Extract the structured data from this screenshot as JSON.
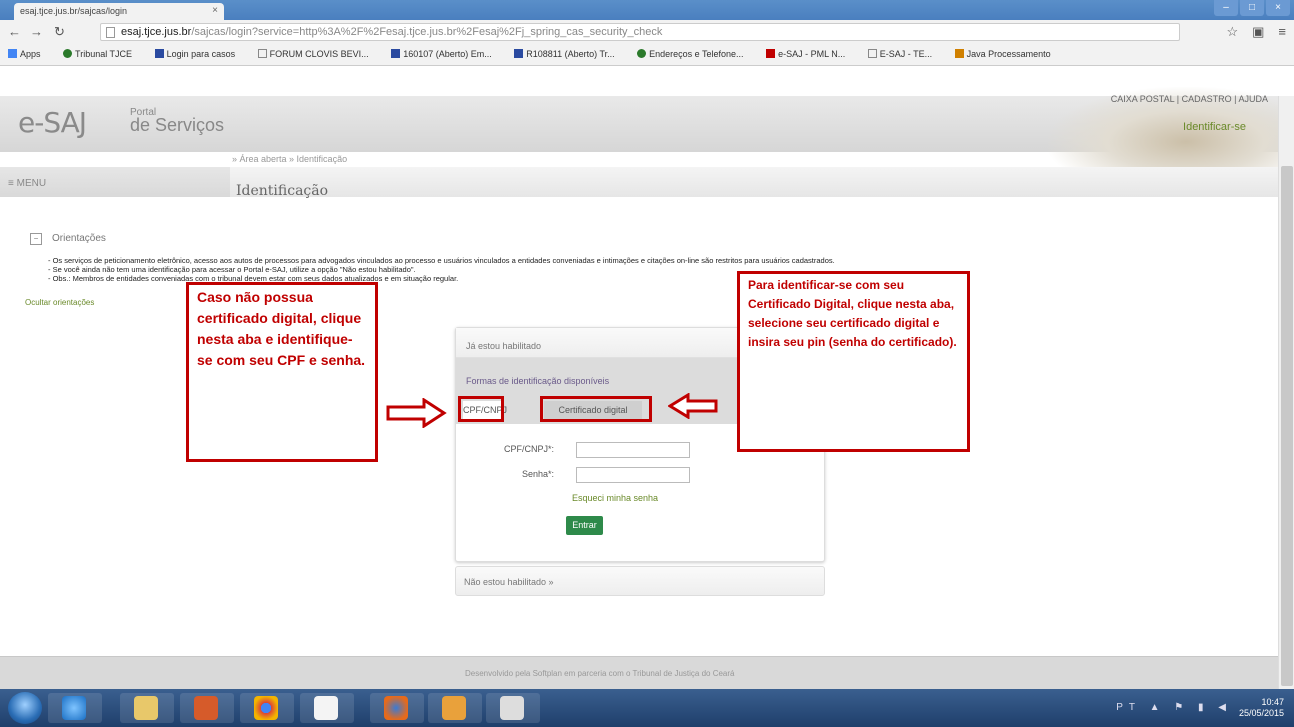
{
  "browser": {
    "tab_title": "esaj.tjce.jus.br/sajcas/login",
    "tab_close": "×",
    "url_host": "esaj.tjce.jus.br",
    "url_path": "/sajcas/login?service=http%3A%2F%2Fesaj.tjce.jus.br%2Fesaj%2Fj_spring_cas_security_check",
    "bookmarks": [
      {
        "label": "Apps",
        "color": "#4285f4"
      },
      {
        "label": "Tribunal TJCE",
        "color": "#2b7a2b"
      },
      {
        "label": "Login para casos",
        "color": "#2a4aa0"
      },
      {
        "label": "FORUM CLOVIS BEVI...",
        "color": "#888888"
      },
      {
        "label": "160107 (Aberto) Em...",
        "color": "#2a4aa0"
      },
      {
        "label": "R108811 (Aberto) Tr...",
        "color": "#2a4aa0"
      },
      {
        "label": "Endereços e Telefone...",
        "color": "#2b7a2b"
      },
      {
        "label": "e-SAJ - PML N...",
        "color": "#c00000"
      },
      {
        "label": "E-SAJ - TE...",
        "color": "#888888"
      },
      {
        "label": "Java Processamento",
        "color": "#d08000"
      }
    ]
  },
  "header": {
    "logo": "e-SAJ",
    "portal_small": "Portal",
    "portal_big": "de Serviços",
    "top_links": "CAIXA POSTAL   |   CADASTRO   |   AJUDA",
    "identify_link": "Identificar-se",
    "breadcrumb": "» Área aberta » Identificação",
    "menu": "≡ MENU",
    "page_title": "Identificação"
  },
  "orientations": {
    "title": "Orientações",
    "items": [
      "Os serviços de peticionamento eletrônico, acesso aos autos de processos para advogados vinculados ao processo e usuários vinculados a entidades conveniadas e intimações e citações on-line são restritos para usuários cadastrados.",
      "Se você ainda não tem uma identificação para acessar o Portal e-SAJ, utilize a opção \"Não estou habilitado\".",
      "Obs.: Membros de entidades conveniadas com o tribunal devem estar com seus dados atualizados e em situação regular."
    ],
    "hide_link": "Ocultar orientações"
  },
  "login": {
    "panel_title": "Já estou habilitado",
    "forms_label": "Formas de identificação disponíveis",
    "tab_cpf": "CPF/CNPJ",
    "tab_cert": "Certificado digital",
    "cpf_label": "CPF/CNPJ*:",
    "password_label": "Senha*:",
    "forgot": "Esqueci minha senha",
    "enter": "Entrar",
    "not_enabled": "Não estou habilitado »"
  },
  "annotations": {
    "left": "Caso não possua certificado digital, clique nesta aba e identifique-se com seu CPF e senha.",
    "right": "Para identificar-se com seu Certificado Digital, clique nesta aba, selecione seu certificado digital e insira seu pin (senha do certificado).",
    "color": "#c00000"
  },
  "footer": "Desenvolvido pela Softplan em parceria com o Tribunal de Justiça do Ceará",
  "taskbar": {
    "lang": "PT",
    "time": "10:47",
    "date": "25/05/2015"
  }
}
